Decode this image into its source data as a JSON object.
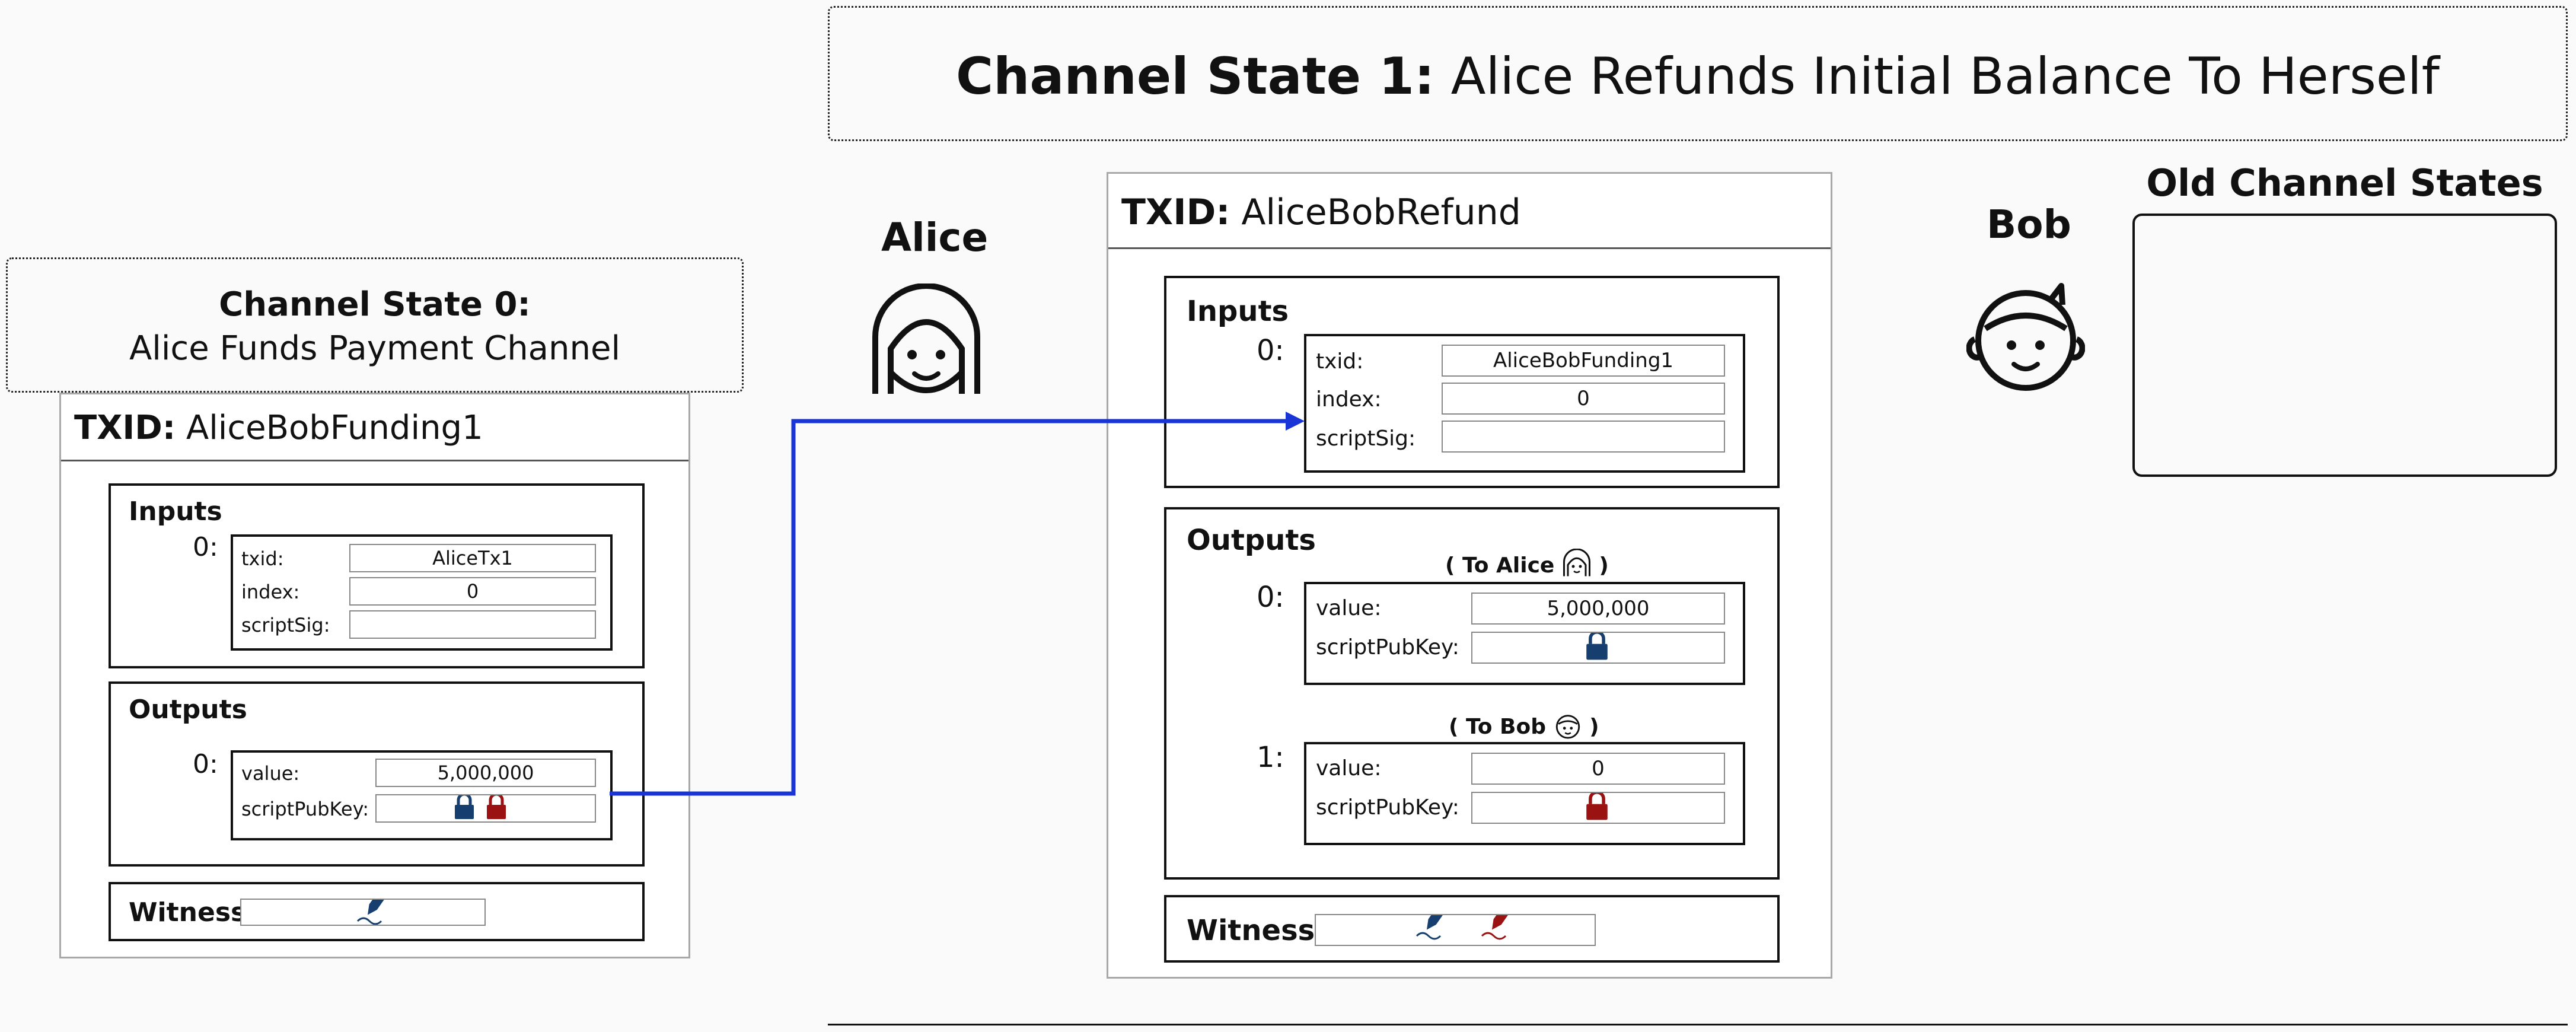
{
  "header": {
    "title_bold": "Channel State 1:",
    "title_rest": " Alice Refunds Initial Balance To Herself"
  },
  "state0": {
    "title_bold": "Channel State 0:",
    "subtitle": "Alice Funds Payment Channel"
  },
  "tx0": {
    "txid_label": "TXID:",
    "txid_value": " AliceBobFunding1",
    "inputs_title": "Inputs",
    "input_index": "0:",
    "txid_field_label": "txid:",
    "txid_field_value": "AliceTx1",
    "index_label": "index:",
    "index_value": "0",
    "scriptsig_label": "scriptSig:",
    "outputs_title": "Outputs",
    "output_index": "0:",
    "value_label": "value:",
    "value_value": "5,000,000",
    "scriptpubkey_label": "scriptPubKey:",
    "witness_title": "Witness"
  },
  "tx1": {
    "txid_label": "TXID:",
    "txid_value": " AliceBobRefund",
    "inputs_title": "Inputs",
    "input_index": "0:",
    "txid_field_label": "txid:",
    "txid_field_value": "AliceBobFunding1",
    "index_label": "index:",
    "index_value": "0",
    "scriptsig_label": "scriptSig:",
    "outputs_title": "Outputs",
    "to_alice_open": "( To Alice",
    "to_alice_close": ")",
    "out0_index": "0:",
    "out0_value_label": "value:",
    "out0_value": "5,000,000",
    "out0_spk_label": "scriptPubKey:",
    "to_bob_open": "( To Bob",
    "to_bob_close": ")",
    "out1_index": "1:",
    "out1_value_label": "value:",
    "out1_value": "0",
    "out1_spk_label": "scriptPubKey:",
    "witness_title": "Witness"
  },
  "people": {
    "alice": "Alice",
    "bob": "Bob"
  },
  "old_states": {
    "title": "Old Channel States"
  },
  "colors": {
    "alice": "#163e6e",
    "bob": "#9a1212",
    "arrow": "#1a35d6"
  },
  "icons": [
    "alice-face-icon",
    "bob-face-icon",
    "padlock-icon",
    "fountain-pen-icon"
  ]
}
